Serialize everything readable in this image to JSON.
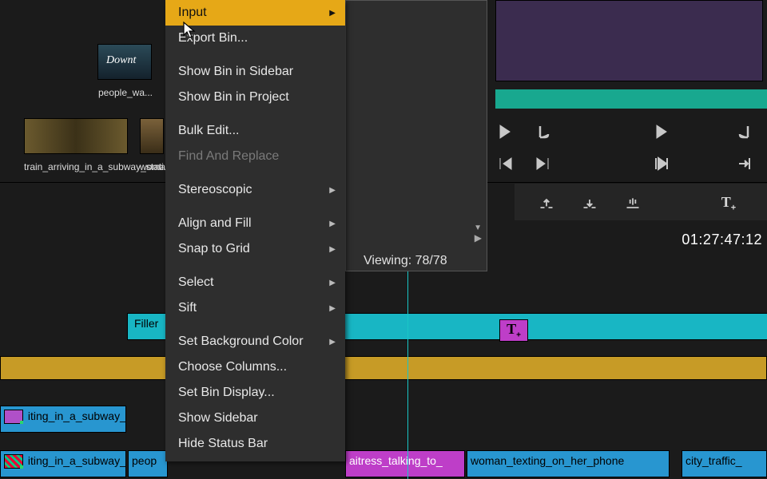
{
  "thumbnails": {
    "t1_label": "people_wa...",
    "t1_overlay": "Downt",
    "t2_label": "train_arriving_in_a_subway_stati...",
    "t3_label": "woman_talking_on_a..."
  },
  "menu": {
    "input": "Input",
    "export_bin": "Export Bin...",
    "show_sidebar": "Show Bin in Sidebar",
    "show_project": "Show Bin in Project",
    "bulk_edit": "Bulk Edit...",
    "find_replace": "Find And Replace",
    "stereoscopic": "Stereoscopic",
    "align_fill": "Align and Fill",
    "snap_grid": "Snap to Grid",
    "select": "Select",
    "sift": "Sift",
    "bg_color": "Set Background Color",
    "choose_cols": "Choose Columns...",
    "bin_display": "Set Bin Display...",
    "show_sb": "Show Sidebar",
    "hide_status": "Hide Status Bar"
  },
  "viewing": "Viewing: 78/78",
  "timecode": "01:27:47:12",
  "timeline": {
    "filler": "Filler",
    "subway1": "iting_in_a_subway_",
    "subway2": "iting_in_a_subway_",
    "peop": "peop",
    "waitress": "aitress_talking_to_",
    "woman_text": "woman_texting_on_her_phone",
    "city": "city_traffic_"
  },
  "icons": {
    "play": "play-icon",
    "mark_out": "mark-out-icon",
    "mark_in": "mark-in-icon",
    "step_back": "step-back-icon",
    "step_fwd": "step-fwd-icon",
    "goto_in": "goto-in-icon",
    "goto_out": "goto-out-icon",
    "lift": "lift-icon",
    "extract": "extract-icon",
    "overwrite": "overwrite-icon",
    "text_tool": "text-tool-icon"
  }
}
